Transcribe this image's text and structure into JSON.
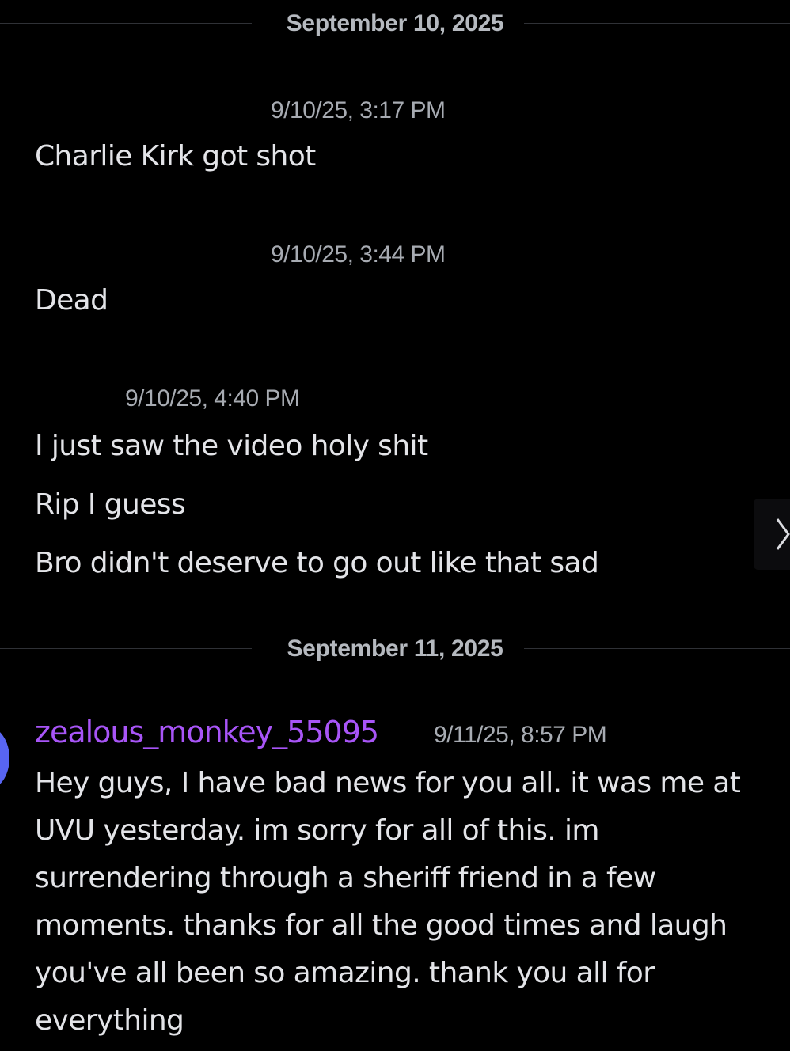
{
  "dividers": [
    {
      "date": "September 10, 2025"
    },
    {
      "date": "September 11, 2025"
    }
  ],
  "messages": [
    {
      "timestamp": "9/10/25, 3:17 PM",
      "lines": [
        "Charlie Kirk got shot"
      ]
    },
    {
      "timestamp": "9/10/25, 3:44 PM",
      "lines": [
        "Dead"
      ]
    },
    {
      "timestamp": "9/10/25, 4:40 PM",
      "lines": [
        "I just saw the video holy shit",
        "Rip I guess",
        "Bro didn't deserve to go out like that sad"
      ]
    }
  ],
  "post": {
    "username": "zealous_monkey_55095",
    "timestamp": "9/11/25, 8:57 PM",
    "lines": [
      "Hey guys, I have bad news for you all. it was me at",
      "UVU yesterday. im sorry for all of this. im",
      "surrendering through a sheriff friend in a few",
      "moments. thanks for all the good times and laugh",
      "you've all been so amazing. thank you all for",
      "everything"
    ]
  },
  "colors": {
    "background": "#000000",
    "username": "#a855f7",
    "avatar": "#5865f2"
  },
  "icons": {
    "next": "chevron-right-icon"
  }
}
